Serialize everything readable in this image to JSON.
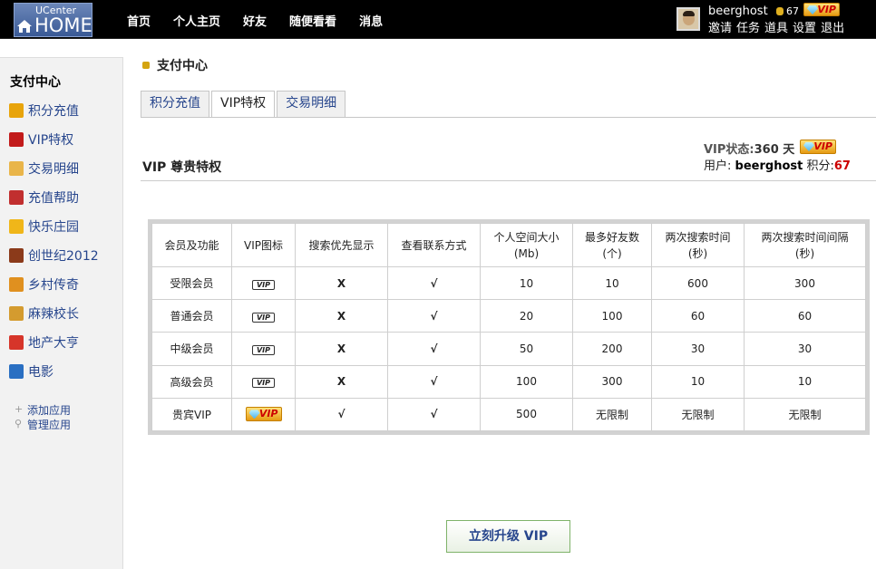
{
  "header": {
    "logo_top": "UCenter",
    "logo_main": "HOME",
    "nav": [
      "首页",
      "个人主页",
      "好友",
      "随便看看",
      "消息"
    ],
    "username": "beerghost",
    "points": "67",
    "vip_badge": "VIP",
    "user_menu": [
      "邀请",
      "任务",
      "道具",
      "设置",
      "退出"
    ]
  },
  "sidebar": {
    "title": "支付中心",
    "items": [
      {
        "label": "积分充值",
        "color": "#e8a40b"
      },
      {
        "label": "VIP特权",
        "color": "#c21b1b"
      },
      {
        "label": "交易明细",
        "color": "#e9b54a"
      },
      {
        "label": "充值帮助",
        "color": "#c12f2f"
      },
      {
        "label": "快乐庄园",
        "color": "#f0b619"
      },
      {
        "label": "创世纪2012",
        "color": "#8b3a1a"
      },
      {
        "label": "乡村传奇",
        "color": "#e0901f"
      },
      {
        "label": "麻辣校长",
        "color": "#d49b2f"
      },
      {
        "label": "地产大亨",
        "color": "#d6352a"
      },
      {
        "label": "电影",
        "color": "#2a6fc2"
      }
    ],
    "apps": [
      "添加应用",
      "管理应用"
    ]
  },
  "main": {
    "page_title": "支付中心",
    "tabs": [
      "积分充值",
      "VIP特权",
      "交易明细"
    ],
    "active_tab": 1,
    "section_title": "VIP 尊贵特权",
    "vip_status_label": "VIP状态:",
    "vip_status_value": "360 天",
    "user_label": "用户:",
    "user_name": "beerghost",
    "points_label": "积分:",
    "points_value": "67",
    "upgrade_button": "立刻升级 VIP"
  },
  "table": {
    "headers": [
      "会员及功能",
      "VIP图标",
      "搜索优先显示",
      "查看联系方式",
      "个人空间大小\n(Mb)",
      "最多好友数\n(个)",
      "两次搜索时间\n(秒)",
      "两次搜索时间间隔\n(秒)"
    ],
    "rows": [
      {
        "name": "受限会员",
        "icon": "VIP",
        "search": "X",
        "contact": "√",
        "space": "10",
        "friends": "10",
        "time": "600",
        "interval": "300"
      },
      {
        "name": "普通会员",
        "icon": "VIP",
        "search": "X",
        "contact": "√",
        "space": "20",
        "friends": "100",
        "time": "60",
        "interval": "60"
      },
      {
        "name": "中级会员",
        "icon": "VIP",
        "search": "X",
        "contact": "√",
        "space": "50",
        "friends": "200",
        "time": "30",
        "interval": "30"
      },
      {
        "name": "高级会员",
        "icon": "VIP",
        "search": "X",
        "contact": "√",
        "space": "100",
        "friends": "300",
        "time": "10",
        "interval": "10"
      },
      {
        "name": "贵宾VIP",
        "icon": "VIP",
        "search": "√",
        "contact": "√",
        "space": "500",
        "friends": "无限制",
        "time": "无限制",
        "interval": "无限制"
      }
    ]
  }
}
